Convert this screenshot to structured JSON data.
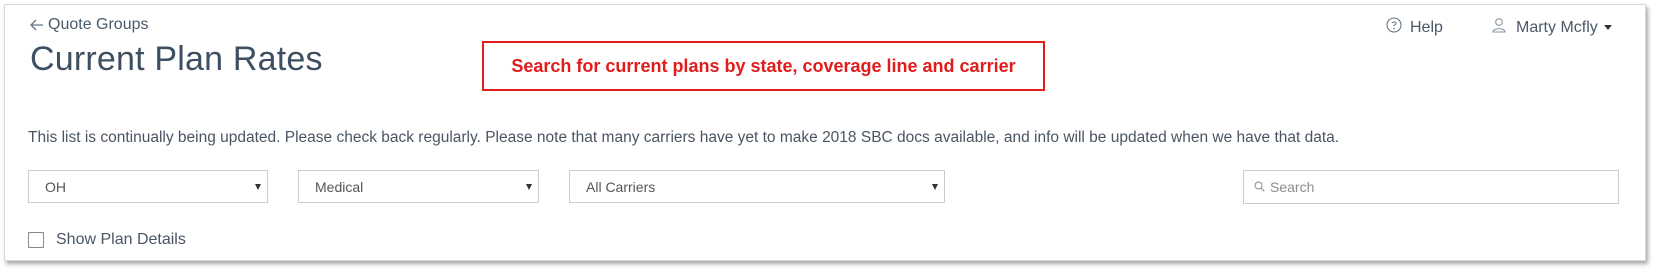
{
  "header": {
    "back_label": "Quote Groups",
    "title": "Current Plan Rates",
    "help_label": "Help",
    "user_name": "Marty Mcfly"
  },
  "annotation": {
    "text": "Search for current plans by state, coverage line and carrier",
    "color": "#e21b1b"
  },
  "notice": "This list is continually being updated. Please check back regularly. Please note that many carriers have yet to make 2018 SBC docs available, and info will be updated when we have that data.",
  "filters": {
    "state": "OH",
    "coverage_line": "Medical",
    "carrier": "All Carriers",
    "search_placeholder": "Search"
  },
  "options": {
    "show_plan_details_label": "Show Plan Details",
    "show_plan_details_checked": false
  },
  "icons": {
    "back": "arrow-left-icon",
    "help": "question-circle-icon",
    "user": "user-icon",
    "search": "search-icon"
  }
}
